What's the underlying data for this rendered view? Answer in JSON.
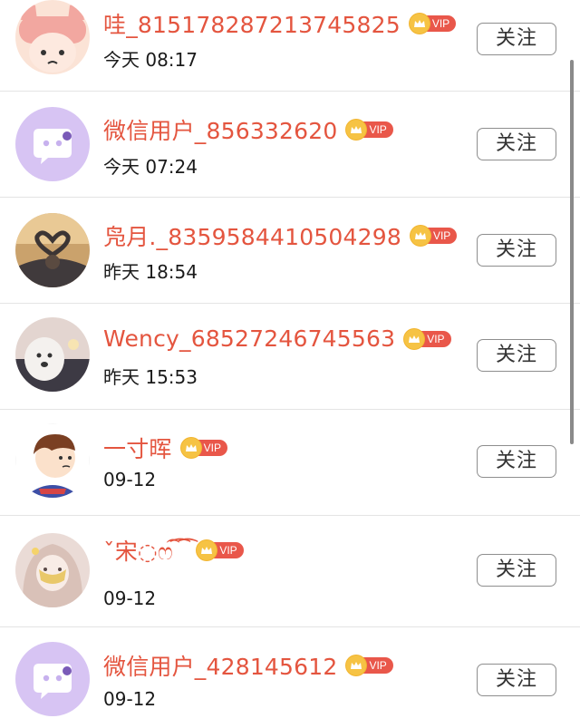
{
  "users": [
    {
      "name": "哇_815178287213745825",
      "time": "今天 08:17",
      "vip": "VIP",
      "follow": "关注",
      "avatar": "cartoon-pig-avatar"
    },
    {
      "name": "微信用户_856332620",
      "time": "今天 07:24",
      "vip": "VIP",
      "follow": "关注",
      "avatar": "wechat-default-avatar"
    },
    {
      "name": "凫月._8359584410504298",
      "time": "昨天 18:54",
      "vip": "VIP",
      "follow": "关注",
      "avatar": "heart-hands-photo-avatar"
    },
    {
      "name": "Wency_68527246745563",
      "time": "昨天 15:53",
      "vip": "VIP",
      "follow": "关注",
      "avatar": "dog-photo-avatar"
    },
    {
      "name": "一寸晖",
      "time": "09-12",
      "vip": "VIP",
      "follow": "关注",
      "avatar": "cartoon-boy-avatar"
    },
    {
      "name": "ˇ宋◌ෆ͡ ͡ ͡",
      "time": "09-12",
      "vip": "VIP",
      "follow": "关注",
      "avatar": "anime-girl-avatar"
    },
    {
      "name": "微信用户_428145612",
      "time": "09-12",
      "vip": "VIP",
      "follow": "关注",
      "avatar": "wechat-default-avatar"
    }
  ],
  "colors": {
    "name": "#e4553f",
    "vip_tag": "#e9574a",
    "crown": "#f6c344",
    "divider": "#e4e4e4",
    "wechat_avatar": "#d7c4f3"
  }
}
